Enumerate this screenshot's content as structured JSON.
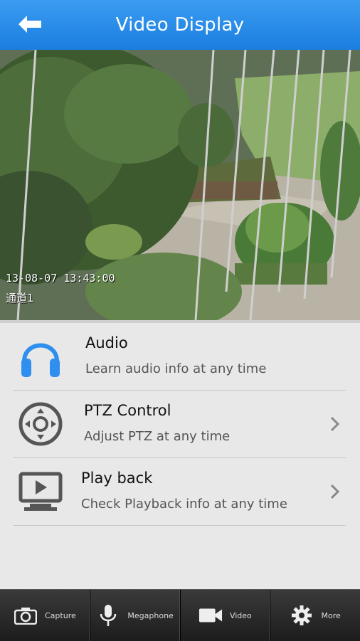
{
  "header": {
    "title": "Video Display",
    "back_icon": "arrow-left-icon"
  },
  "video": {
    "timestamp": "13-08-07 13:43:00",
    "channel": "通道1"
  },
  "list": [
    {
      "icon": "headphones-icon",
      "title": "Audio",
      "subtitle": "Learn audio info at any time",
      "has_chevron": false
    },
    {
      "icon": "ptz-joystick-icon",
      "title": "PTZ Control",
      "subtitle": "Adjust PTZ at any time",
      "has_chevron": true
    },
    {
      "icon": "playback-monitor-icon",
      "title": "Play back",
      "subtitle": "Check Playback info at any time",
      "has_chevron": true
    }
  ],
  "tabs": [
    {
      "icon": "camera-icon",
      "label": "Capture"
    },
    {
      "icon": "microphone-icon",
      "label": "Megaphone"
    },
    {
      "icon": "video-camera-icon",
      "label": "Video"
    },
    {
      "icon": "gear-icon",
      "label": "More"
    }
  ],
  "colors": {
    "header": "#1a7ee0",
    "accent_icon": "#2f8fef",
    "icon_gray": "#555555",
    "tabbar": "#2a2a2a"
  }
}
